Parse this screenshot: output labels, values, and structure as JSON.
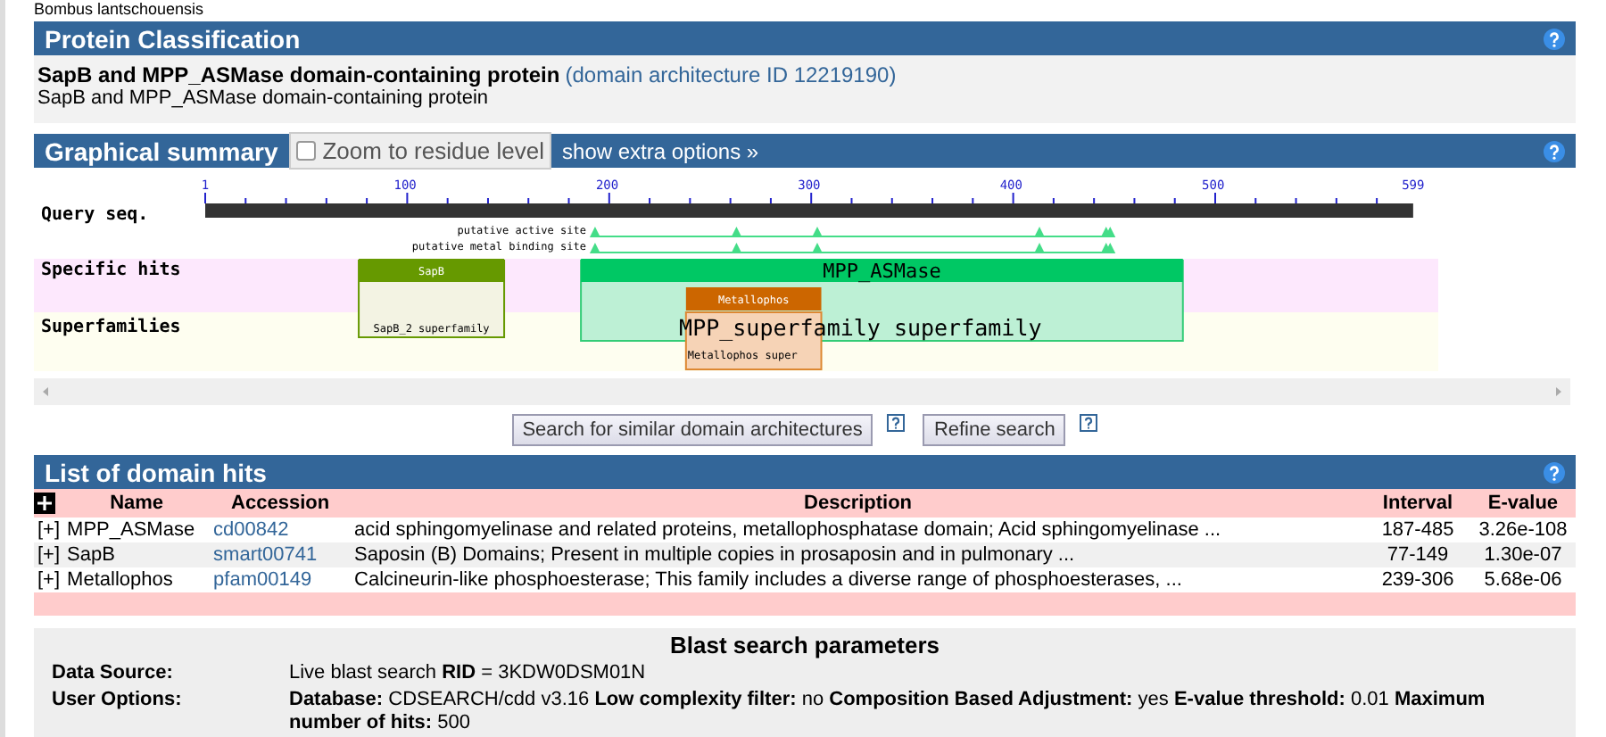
{
  "top_text": "Bombus lantschouensis",
  "classification": {
    "title": "Protein Classification",
    "name": "SapB and MPP_ASMase domain-containing protein",
    "arch_link": "(domain architecture ID 12219190)",
    "subtitle": "SapB and MPP_ASMase domain-containing protein"
  },
  "graphical_summary": {
    "title": "Graphical summary",
    "zoom_checkbox": {
      "label": "Zoom to residue level",
      "checked": false
    },
    "extra_options_link": "show extra options »",
    "axis_ticks": [
      "1",
      "100",
      "200",
      "300",
      "400",
      "500",
      "599"
    ],
    "query_label": "Query seq.",
    "site_tracks": [
      {
        "label": "putative active site"
      },
      {
        "label": "putative metal binding site"
      }
    ],
    "row_labels": [
      "Specific hits",
      "Superfamilies"
    ],
    "specific_hits": [
      {
        "label": "SapB"
      },
      {
        "label": "MPP_ASMase"
      },
      {
        "label": "Metallophos"
      }
    ],
    "superfamilies": [
      {
        "label": "SapB_2 superfamily"
      },
      {
        "label": "MPP_superfamily superfamily"
      },
      {
        "label": "Metallophos super"
      }
    ]
  },
  "buttons": [
    "Search for similar domain architectures",
    "Refine search"
  ],
  "domain_hits": {
    "title": "List of domain hits",
    "columns": [
      "Name",
      "Accession",
      "Description",
      "Interval",
      "E-value"
    ],
    "rows": [
      {
        "toggle": "[+]",
        "name": "MPP_ASMase",
        "accession": "cd00842",
        "description": "acid sphingomyelinase and related proteins, metallophosphatase domain; Acid sphingomyelinase ...",
        "interval": "187-485",
        "evalue": "3.26e-108"
      },
      {
        "toggle": "[+]",
        "name": "SapB",
        "accession": "smart00741",
        "description": "Saposin (B) Domains; Present in multiple copies in prosaposin and in pulmonary ...",
        "interval": "77-149",
        "evalue": "1.30e-07"
      },
      {
        "toggle": "[+]",
        "name": "Metallophos",
        "accession": "pfam00149",
        "description": "Calcineurin-like phosphoesterase; This family includes a diverse range of phosphoesterases, ...",
        "interval": "239-306",
        "evalue": "5.68e-06"
      }
    ]
  },
  "blast_parameters": {
    "title": "Blast search parameters",
    "rows": [
      {
        "label": "Data Source:",
        "value": "Live blast search **RID** = 3KDW0DSM01N"
      },
      {
        "label": "User Options:",
        "value": "**Database:** CDSEARCH/cdd v3.16  **Low complexity filter:** no  **Composition Based Adjustment:** yes  **E-value threshold:** 0.01  **Maximum number of hits:** 500"
      }
    ]
  }
}
